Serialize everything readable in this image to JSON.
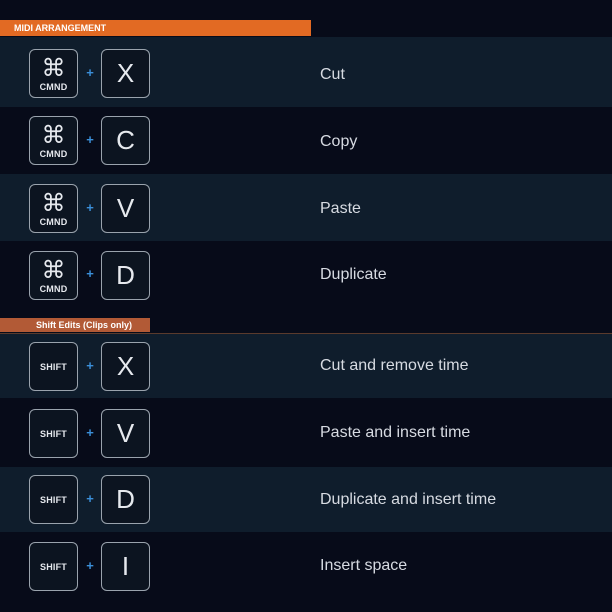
{
  "sections": [
    {
      "title": "MIDI ARRANGEMENT",
      "rows": [
        {
          "modifier_glyph": "⌘",
          "modifier_label": "CMND",
          "plus": "+",
          "key": "X",
          "action": "Cut"
        },
        {
          "modifier_glyph": "⌘",
          "modifier_label": "CMND",
          "plus": "+",
          "key": "C",
          "action": "Copy"
        },
        {
          "modifier_glyph": "⌘",
          "modifier_label": "CMND",
          "plus": "+",
          "key": "V",
          "action": "Paste"
        },
        {
          "modifier_glyph": "⌘",
          "modifier_label": "CMND",
          "plus": "+",
          "key": "D",
          "action": "Duplicate"
        }
      ]
    },
    {
      "title": "Shift Edits (Clips only)",
      "rows": [
        {
          "modifier_label": "SHIFT",
          "plus": "+",
          "key": "X",
          "action": "Cut and remove time"
        },
        {
          "modifier_label": "SHIFT",
          "plus": "+",
          "key": "V",
          "action": "Paste and insert time"
        },
        {
          "modifier_label": "SHIFT",
          "plus": "+",
          "key": "D",
          "action": "Duplicate and insert time"
        },
        {
          "modifier_label": "SHIFT",
          "plus": "+",
          "key": "I",
          "action": "Insert space"
        }
      ]
    }
  ],
  "colors": {
    "background": "#070b19",
    "row_alt": "#0f1d2c",
    "header_primary": "#e26a23",
    "header_secondary": "#b25a36",
    "plus_accent": "#3b8fd9"
  }
}
